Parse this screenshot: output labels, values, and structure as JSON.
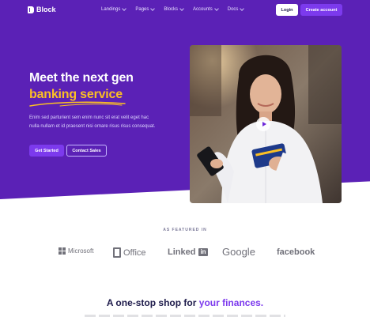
{
  "brand": {
    "name": "Block"
  },
  "nav": {
    "items": [
      {
        "label": "Landings"
      },
      {
        "label": "Pages"
      },
      {
        "label": "Blocks"
      },
      {
        "label": "Accounts"
      },
      {
        "label": "Docs"
      }
    ],
    "login_label": "Login",
    "create_label": "Create account"
  },
  "hero": {
    "title_line1": "Meet the next gen",
    "title_line2": "banking service",
    "lead": "Enim sed parturient sem enim nunc sit erat velit eget hac nulla nullam et id praesent nisi ornare risus risus consequat.",
    "primary_cta": "Get Started",
    "secondary_cta": "Contact Sales"
  },
  "featured": {
    "label": "AS FEATURED IN",
    "logos": [
      {
        "name": "Microsoft"
      },
      {
        "name": "Office"
      },
      {
        "name": "Linked",
        "suffix": "in"
      },
      {
        "name": "Google"
      },
      {
        "name": "facebook"
      }
    ]
  },
  "section": {
    "title_prefix": "A one-stop shop for ",
    "title_accent": "your finances."
  },
  "colors": {
    "hero_bg": "#5b21b6",
    "accent": "#7c3aed",
    "highlight": "#fbbf24"
  }
}
